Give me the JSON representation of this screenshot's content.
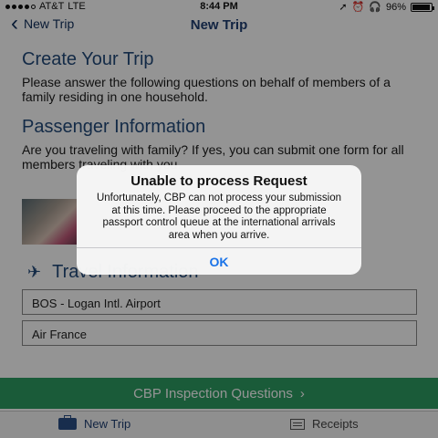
{
  "status_bar": {
    "carrier": "AT&T",
    "network": "LTE",
    "time": "8:44 PM",
    "battery_text": "96%",
    "battery_level": 0.96,
    "indicators": [
      "location-icon",
      "alarm-icon",
      "headphones-icon"
    ]
  },
  "nav": {
    "back_label": "New Trip",
    "title": "New Trip"
  },
  "content": {
    "create_heading": "Create Your Trip",
    "create_text": "Please answer the following questions on behalf of members of a family residing in one household.",
    "passenger_heading": "Passenger Information",
    "passenger_text": "Are you traveling with family? If yes, you can submit one form for all members traveling with you.",
    "travel_heading": "Travel Information",
    "airport": "BOS - Logan Intl. Airport",
    "airline": "Air France",
    "cbp_button": "CBP Inspection Questions",
    "cbp_arrow": "›"
  },
  "tabs": {
    "new_trip": "New Trip",
    "receipts": "Receipts"
  },
  "alert": {
    "title": "Unable to process Request",
    "message": "Unfortunately, CBP can not process your submission at this time. Please proceed to the appropriate passport control queue at the international arrivals area when you arrive.",
    "ok_label": "OK"
  },
  "colors": {
    "accent_blue": "#234a7a",
    "button_green": "#2e9d63",
    "alert_button": "#1a73e8"
  }
}
